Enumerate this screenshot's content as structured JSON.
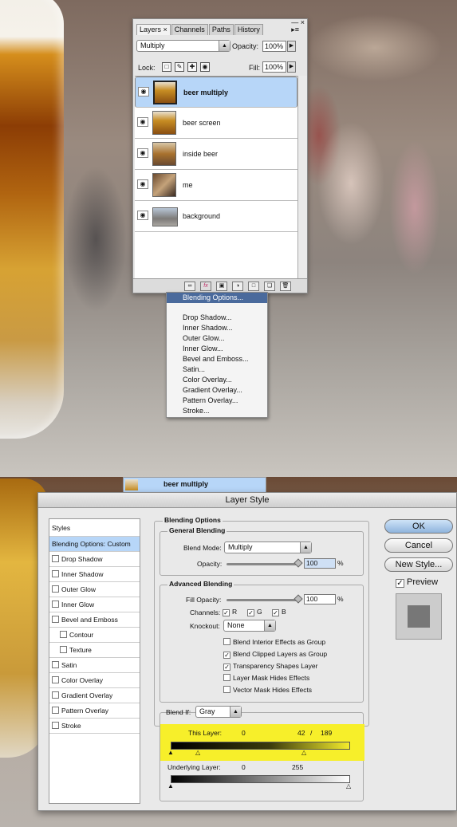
{
  "layers_panel": {
    "tabs": [
      "Layers ×",
      "Channels",
      "Paths",
      "History"
    ],
    "blend_mode": "Multiply",
    "opacity_label": "Opacity:",
    "opacity_value": "100%",
    "lock_label": "Lock:",
    "fill_label": "Fill:",
    "fill_value": "100%",
    "layers": [
      {
        "name": "beer multiply",
        "selected": true
      },
      {
        "name": "beer screen"
      },
      {
        "name": "inside beer"
      },
      {
        "name": "me"
      },
      {
        "name": "background"
      }
    ]
  },
  "fx_menu": {
    "items": [
      "Blending Options...",
      "Drop Shadow...",
      "Inner Shadow...",
      "Outer Glow...",
      "Inner Glow...",
      "Bevel and Emboss...",
      "Satin...",
      "Color Overlay...",
      "Gradient Overlay...",
      "Pattern Overlay...",
      "Stroke..."
    ]
  },
  "strip_label": "beer multiply",
  "dialog": {
    "title": "Layer Style",
    "styles_header": "Styles",
    "styles": [
      {
        "label": "Blending Options: Custom",
        "selected": true
      },
      {
        "label": "Drop Shadow"
      },
      {
        "label": "Inner Shadow"
      },
      {
        "label": "Outer Glow"
      },
      {
        "label": "Inner Glow"
      },
      {
        "label": "Bevel and Emboss"
      },
      {
        "label": "Contour"
      },
      {
        "label": "Texture"
      },
      {
        "label": "Satin"
      },
      {
        "label": "Color Overlay"
      },
      {
        "label": "Gradient Overlay"
      },
      {
        "label": "Pattern Overlay"
      },
      {
        "label": "Stroke"
      }
    ],
    "blending_options_title": "Blending Options",
    "general_title": "General Blending",
    "blend_mode_label": "Blend Mode:",
    "blend_mode_value": "Multiply",
    "opacity_label": "Opacity:",
    "opacity_value": "100",
    "percent": "%",
    "advanced_title": "Advanced Blending",
    "fill_opacity_label": "Fill Opacity:",
    "fill_opacity_value": "100",
    "channels_label": "Channels:",
    "channels": [
      "R",
      "G",
      "B"
    ],
    "knockout_label": "Knockout:",
    "knockout_value": "None",
    "checkboxes": [
      {
        "label": "Blend Interior Effects as Group",
        "checked": false
      },
      {
        "label": "Blend Clipped Layers as Group",
        "checked": true
      },
      {
        "label": "Transparency Shapes Layer",
        "checked": true
      },
      {
        "label": "Layer Mask Hides Effects",
        "checked": false
      },
      {
        "label": "Vector Mask Hides Effects",
        "checked": false
      }
    ],
    "blend_if_label": "Blend If:",
    "blend_if_value": "Gray",
    "this_layer_label": "This Layer:",
    "this_layer_low": "0",
    "this_layer_mid": "42",
    "this_layer_sep": "/",
    "this_layer_high": "189",
    "underlying_label": "Underlying Layer:",
    "underlying_low": "0",
    "underlying_high": "255",
    "buttons": {
      "ok": "OK",
      "cancel": "Cancel",
      "new_style": "New Style...",
      "preview": "Preview"
    }
  },
  "colors": {
    "selection": "#b7d6f8",
    "menu_highlight": "#4a6a9c",
    "blend_if_highlight": "#f7ef2a",
    "fx_icon": "#c0306a"
  }
}
